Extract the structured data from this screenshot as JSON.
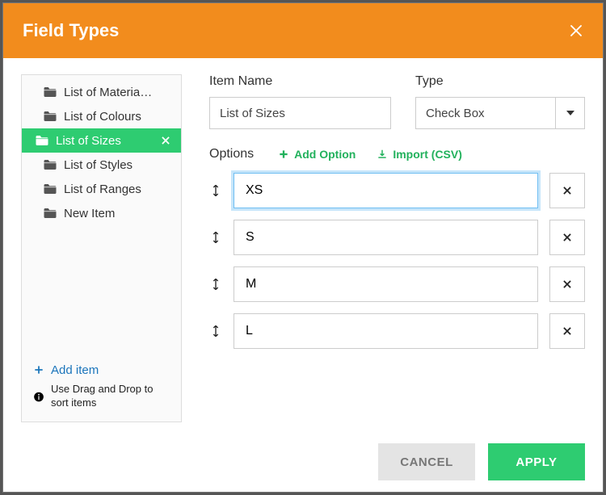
{
  "header": {
    "title": "Field Types"
  },
  "sidebar": {
    "items": [
      {
        "label": "List of Materia…",
        "active": false
      },
      {
        "label": "List of Colours",
        "active": false
      },
      {
        "label": "List of Sizes",
        "active": true
      },
      {
        "label": "List of Styles",
        "active": false
      },
      {
        "label": "List of Ranges",
        "active": false
      },
      {
        "label": "New Item",
        "active": false
      }
    ],
    "add_item_label": "Add item",
    "hint_text": "Use Drag and Drop to sort items"
  },
  "main": {
    "item_name_label": "Item Name",
    "item_name_value": "List of Sizes",
    "type_label": "Type",
    "type_value": "Check Box",
    "options_label": "Options",
    "add_option_label": "Add Option",
    "import_label": "Import (CSV)",
    "options": [
      {
        "value": "XS",
        "focused": true
      },
      {
        "value": "S",
        "focused": false
      },
      {
        "value": "M",
        "focused": false
      },
      {
        "value": "L",
        "focused": false
      }
    ]
  },
  "footer": {
    "cancel_label": "Cancel",
    "apply_label": "Apply"
  }
}
